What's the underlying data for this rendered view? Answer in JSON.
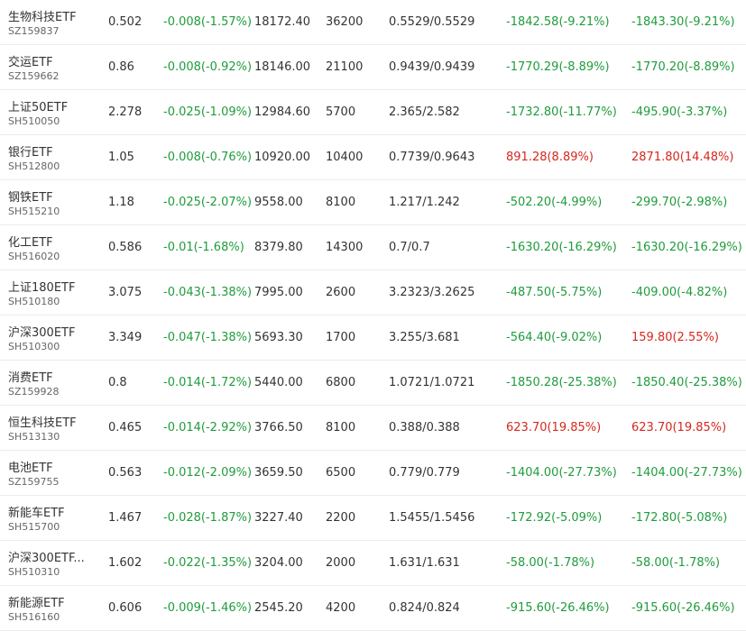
{
  "colors": {
    "gain": "#d5281d",
    "loss": "#1f9c3c"
  },
  "rows": [
    {
      "name": "生物科技ETF",
      "code": "SZ159837",
      "price": "0.502",
      "change": "-0.008(-1.57%)",
      "value": "18172.40",
      "shares": "36200",
      "cost": "0.5529/0.5529",
      "pl1": "-1842.58(-9.21%)",
      "pl2": "-1843.30(-9.21%)",
      "pl1_dir": "down",
      "pl2_dir": "down"
    },
    {
      "name": "交运ETF",
      "code": "SZ159662",
      "price": "0.86",
      "change": "-0.008(-0.92%)",
      "value": "18146.00",
      "shares": "21100",
      "cost": "0.9439/0.9439",
      "pl1": "-1770.29(-8.89%)",
      "pl2": "-1770.20(-8.89%)",
      "pl1_dir": "down",
      "pl2_dir": "down"
    },
    {
      "name": "上证50ETF",
      "code": "SH510050",
      "price": "2.278",
      "change": "-0.025(-1.09%)",
      "value": "12984.60",
      "shares": "5700",
      "cost": "2.365/2.582",
      "pl1": "-1732.80(-11.77%)",
      "pl2": "-495.90(-3.37%)",
      "pl1_dir": "down",
      "pl2_dir": "down"
    },
    {
      "name": "银行ETF",
      "code": "SH512800",
      "price": "1.05",
      "change": "-0.008(-0.76%)",
      "value": "10920.00",
      "shares": "10400",
      "cost": "0.7739/0.9643",
      "pl1": "891.28(8.89%)",
      "pl2": "2871.80(14.48%)",
      "pl1_dir": "up",
      "pl2_dir": "up"
    },
    {
      "name": "钢铁ETF",
      "code": "SH515210",
      "price": "1.18",
      "change": "-0.025(-2.07%)",
      "value": "9558.00",
      "shares": "8100",
      "cost": "1.217/1.242",
      "pl1": "-502.20(-4.99%)",
      "pl2": "-299.70(-2.98%)",
      "pl1_dir": "down",
      "pl2_dir": "down"
    },
    {
      "name": "化工ETF",
      "code": "SH516020",
      "price": "0.586",
      "change": "-0.01(-1.68%)",
      "value": "8379.80",
      "shares": "14300",
      "cost": "0.7/0.7",
      "pl1": "-1630.20(-16.29%)",
      "pl2": "-1630.20(-16.29%)",
      "pl1_dir": "down",
      "pl2_dir": "down"
    },
    {
      "name": "上证180ETF",
      "code": "SH510180",
      "price": "3.075",
      "change": "-0.043(-1.38%)",
      "value": "7995.00",
      "shares": "2600",
      "cost": "3.2323/3.2625",
      "pl1": "-487.50(-5.75%)",
      "pl2": "-409.00(-4.82%)",
      "pl1_dir": "down",
      "pl2_dir": "down"
    },
    {
      "name": "沪深300ETF",
      "code": "SH510300",
      "price": "3.349",
      "change": "-0.047(-1.38%)",
      "value": "5693.30",
      "shares": "1700",
      "cost": "3.255/3.681",
      "pl1": "-564.40(-9.02%)",
      "pl2": "159.80(2.55%)",
      "pl1_dir": "down",
      "pl2_dir": "up"
    },
    {
      "name": "消费ETF",
      "code": "SZ159928",
      "price": "0.8",
      "change": "-0.014(-1.72%)",
      "value": "5440.00",
      "shares": "6800",
      "cost": "1.0721/1.0721",
      "pl1": "-1850.28(-25.38%)",
      "pl2": "-1850.40(-25.38%)",
      "pl1_dir": "down",
      "pl2_dir": "down"
    },
    {
      "name": "恒生科技ETF",
      "code": "SH513130",
      "price": "0.465",
      "change": "-0.014(-2.92%)",
      "value": "3766.50",
      "shares": "8100",
      "cost": "0.388/0.388",
      "pl1": "623.70(19.85%)",
      "pl2": "623.70(19.85%)",
      "pl1_dir": "up",
      "pl2_dir": "up"
    },
    {
      "name": "电池ETF",
      "code": "SZ159755",
      "price": "0.563",
      "change": "-0.012(-2.09%)",
      "value": "3659.50",
      "shares": "6500",
      "cost": "0.779/0.779",
      "pl1": "-1404.00(-27.73%)",
      "pl2": "-1404.00(-27.73%)",
      "pl1_dir": "down",
      "pl2_dir": "down"
    },
    {
      "name": "新能车ETF",
      "code": "SH515700",
      "price": "1.467",
      "change": "-0.028(-1.87%)",
      "value": "3227.40",
      "shares": "2200",
      "cost": "1.5455/1.5456",
      "pl1": "-172.92(-5.09%)",
      "pl2": "-172.80(-5.08%)",
      "pl1_dir": "down",
      "pl2_dir": "down"
    },
    {
      "name": "沪深300ETF...",
      "code": "SH510310",
      "price": "1.602",
      "change": "-0.022(-1.35%)",
      "value": "3204.00",
      "shares": "2000",
      "cost": "1.631/1.631",
      "pl1": "-58.00(-1.78%)",
      "pl2": "-58.00(-1.78%)",
      "pl1_dir": "down",
      "pl2_dir": "down"
    },
    {
      "name": "新能源ETF",
      "code": "SH516160",
      "price": "0.606",
      "change": "-0.009(-1.46%)",
      "value": "2545.20",
      "shares": "4200",
      "cost": "0.824/0.824",
      "pl1": "-915.60(-26.46%)",
      "pl2": "-915.60(-26.46%)",
      "pl1_dir": "down",
      "pl2_dir": "down"
    }
  ]
}
